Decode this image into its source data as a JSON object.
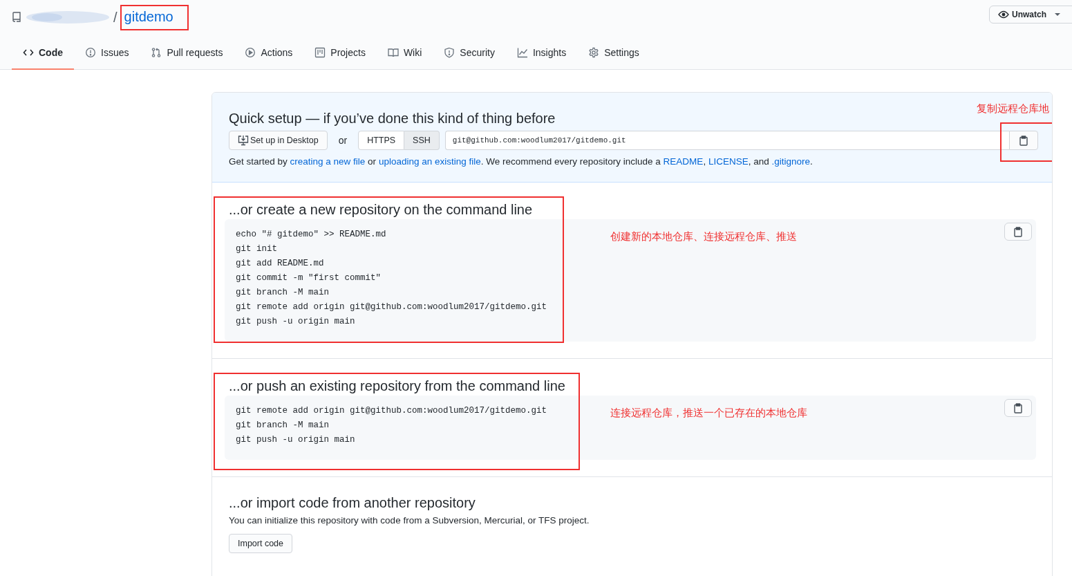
{
  "repo": {
    "separator": "/",
    "name": "gitdemo",
    "annotated": true
  },
  "watch_button": {
    "label": "Unwatch"
  },
  "tabs": [
    {
      "label": "Code",
      "selected": true
    },
    {
      "label": "Issues",
      "selected": false
    },
    {
      "label": "Pull requests",
      "selected": false
    },
    {
      "label": "Actions",
      "selected": false
    },
    {
      "label": "Projects",
      "selected": false
    },
    {
      "label": "Wiki",
      "selected": false
    },
    {
      "label": "Security",
      "selected": false
    },
    {
      "label": "Insights",
      "selected": false
    },
    {
      "label": "Settings",
      "selected": false
    }
  ],
  "quick_setup": {
    "title": "Quick setup — if you’ve done this kind of thing before",
    "desktop_button": "Set up in Desktop",
    "or": "or",
    "protocols": [
      {
        "label": "HTTPS",
        "selected": false
      },
      {
        "label": "SSH",
        "selected": true
      }
    ],
    "clone_url": "git@github.com:woodlum2017/gitdemo.git",
    "copy_annotated": true,
    "annotation": "复制远程仓库地",
    "help": [
      {
        "text": "Get started by "
      },
      {
        "text": "creating a new file",
        "link": true
      },
      {
        "text": " or "
      },
      {
        "text": "uploading an existing file",
        "link": true
      },
      {
        "text": ". We recommend every repository include a "
      },
      {
        "text": "README",
        "link": true
      },
      {
        "text": ", "
      },
      {
        "text": "LICENSE",
        "link": true
      },
      {
        "text": ", and "
      },
      {
        "text": ".gitignore",
        "link": true
      },
      {
        "text": "."
      }
    ]
  },
  "sections": [
    {
      "kind": "commands",
      "title": "...or create a new repository on the command line",
      "annotated": true,
      "annotation": "创建新的本地仓库、连接远程仓库、推送",
      "lines": [
        "echo \"# gitdemo\" >> README.md",
        "git init",
        "git add README.md",
        "git commit -m \"first commit\"",
        "git branch -M main",
        "git remote add origin git@github.com:woodlum2017/gitdemo.git",
        "git push -u origin main"
      ]
    },
    {
      "kind": "commands",
      "title": "...or push an existing repository from the command line",
      "annotated": true,
      "annotation": "连接远程仓库，推送一个已存在的本地仓库",
      "lines": [
        "git remote add origin git@github.com:woodlum2017/gitdemo.git",
        "git branch -M main",
        "git push -u origin main"
      ]
    },
    {
      "kind": "import",
      "title": "...or import code from another repository",
      "description": "You can initialize this repository with code from a Subversion, Mercurial, or TFS project.",
      "button": "Import code"
    }
  ]
}
